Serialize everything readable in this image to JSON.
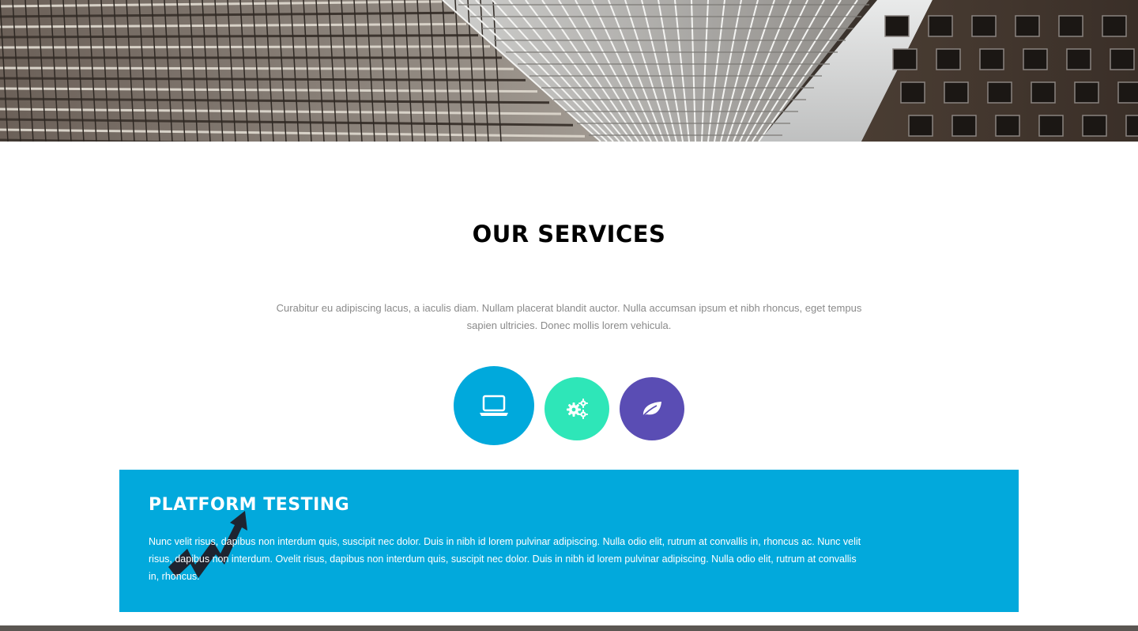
{
  "colors": {
    "tab_laptop": "#00a9dc",
    "tab_gears": "#2ee6b8",
    "tab_leaf": "#5a4db4",
    "panel_bg": "#02a9dc",
    "icon_dark": "#1e2430"
  },
  "hero": {
    "image": "skyscraper-photo"
  },
  "services": {
    "title": "OUR SERVICES",
    "intro": "Curabitur eu adipiscing lacus, a iaculis diam. Nullam placerat blandit auctor. Nulla accumsan ipsum et nibh rhoncus, eget tempus sapien ultricies. Donec mollis lorem vehicula.",
    "tabs": [
      {
        "icon": "laptop-icon",
        "active": true
      },
      {
        "icon": "gears-icon",
        "active": false
      },
      {
        "icon": "leaf-icon",
        "active": false
      }
    ],
    "panel": {
      "icon": "trending-up-arrow-icon",
      "title": "PLATFORM TESTING",
      "text": "Nunc velit risus, dapibus non interdum quis, suscipit nec dolor. Duis in nibh id lorem pulvinar adipiscing. Nulla odio elit, rutrum at convallis in, rhoncus ac. Nunc velit risus, dapibus non interdum. Ovelit risus, dapibus non interdum quis, suscipit nec dolor. Duis in nibh id lorem pulvinar adipiscing. Nulla odio elit, rutrum at convallis in, rhoncus."
    }
  }
}
